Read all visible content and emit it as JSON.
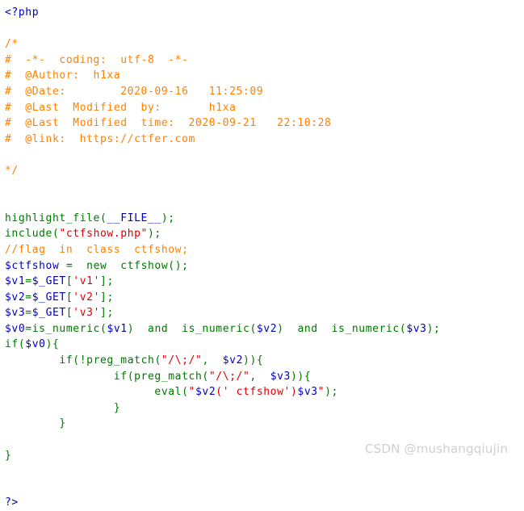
{
  "page": {
    "kind": "php-highlight-file-output",
    "background": "#ffffff"
  },
  "colors": {
    "default": "#0000BB",
    "keyword": "#007700",
    "string": "#DD0000",
    "comment": "#FF8000",
    "variable": "#0000BB",
    "watermark": "#d0d0d0"
  },
  "code": {
    "open_tag": "<?php",
    "close_tag": "?>",
    "header_comment": {
      "open": "/*",
      "lines": [
        "#  -*-  coding:  utf-8  -*-",
        "#  @Author:  h1xa",
        "#  @Date:        2020-09-16   11:25:09",
        "#  @Last  Modified  by:       h1xa",
        "#  @Last  Modified  time:  2020-09-21   22:10:28",
        "#  @link:  https://ctfer.com"
      ],
      "close": "*/"
    },
    "statements": {
      "highlight_file": "highlight_file",
      "file_const": "__FILE__",
      "include": "include",
      "include_arg": "\"ctfshow.php\"",
      "flag_comment": "//flag  in  class  ctfshow;",
      "ctfshow_var": "$ctfshow",
      "assign": "=",
      "new_kw": "new",
      "ctfshow_class": "ctfshow()",
      "v1_var": "$v1",
      "v2_var": "$v2",
      "v3_var": "$v3",
      "v0_var": "$v0",
      "get_super": "$_GET",
      "key_v1": "'v1'",
      "key_v2": "'v2'",
      "key_v3": "'v3'",
      "is_numeric": "is_numeric",
      "and_kw": "and",
      "if_kw": "if",
      "not_op": "!",
      "preg_match": "preg_match",
      "regex": "\"/\\;/\"",
      "eval_kw": "eval",
      "eval_arg_pre": "\"",
      "eval_arg_v2": "$v2",
      "eval_arg_mid": "(' ctfshow')",
      "eval_arg_v3": "$v3",
      "eval_arg_post": "\"",
      "brace_open": "{",
      "brace_close": "}",
      "paren_open": "(",
      "paren_close": ")",
      "bracket_open": "[",
      "bracket_close": "]",
      "semicolon": ";"
    }
  },
  "watermark": {
    "text": "CSDN @mushangqiujin"
  }
}
